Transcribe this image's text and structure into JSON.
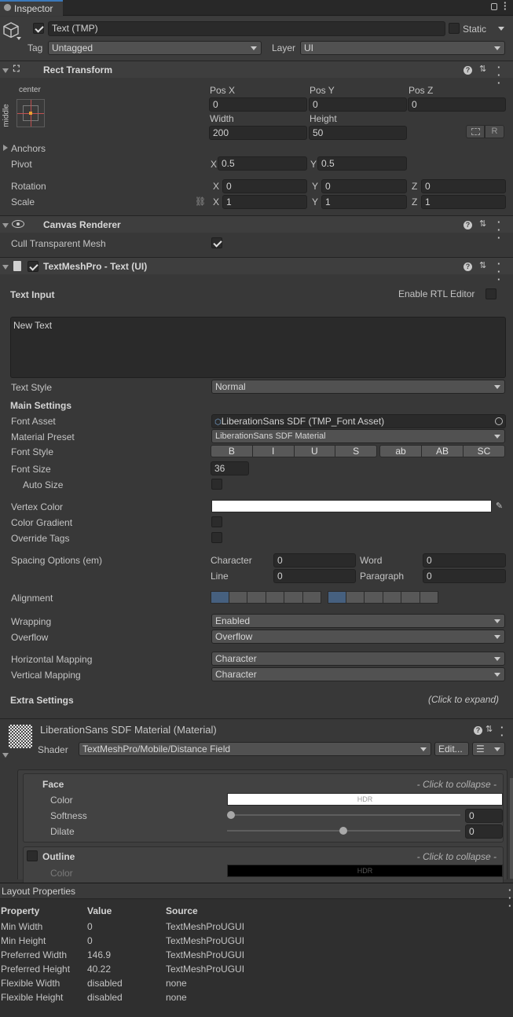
{
  "window": {
    "tab_title": "Inspector"
  },
  "object": {
    "name": "Text (TMP)",
    "active": true,
    "static_label": "Static",
    "static": false,
    "tag_label": "Tag",
    "tag_value": "Untagged",
    "layer_label": "Layer",
    "layer_value": "UI"
  },
  "rect_transform": {
    "title": "Rect Transform",
    "anchor_top": "center",
    "anchor_side": "middle",
    "pos_x_label": "Pos X",
    "pos_x": "0",
    "pos_y_label": "Pos Y",
    "pos_y": "0",
    "pos_z_label": "Pos Z",
    "pos_z": "0",
    "width_label": "Width",
    "width": "200",
    "height_label": "Height",
    "height": "50",
    "r_button": "R",
    "anchors_label": "Anchors",
    "pivot_label": "Pivot",
    "pivot_x": "0.5",
    "pivot_y": "0.5",
    "rotation_label": "Rotation",
    "rot_x": "0",
    "rot_y": "0",
    "rot_z": "0",
    "scale_label": "Scale",
    "scale_x": "1",
    "scale_y": "1",
    "scale_z": "1",
    "axis_x": "X",
    "axis_y": "Y",
    "axis_z": "Z"
  },
  "canvas_renderer": {
    "title": "Canvas Renderer",
    "cull_label": "Cull Transparent Mesh",
    "cull": true
  },
  "tmp": {
    "title": "TextMeshPro - Text (UI)",
    "enabled": true,
    "text_input_label": "Text Input",
    "rtl_label": "Enable RTL Editor",
    "text_value": "New Text",
    "text_style_label": "Text Style",
    "text_style": "Normal",
    "main_settings": "Main Settings",
    "font_asset_label": "Font Asset",
    "font_asset": "LiberationSans SDF (TMP_Font Asset)",
    "material_preset_label": "Material Preset",
    "material_preset": "LiberationSans SDF Material",
    "font_style_label": "Font Style",
    "font_styles": [
      "B",
      "I",
      "U",
      "S",
      "ab",
      "AB",
      "SC"
    ],
    "font_size_label": "Font Size",
    "font_size": "36",
    "auto_size_label": "Auto Size",
    "vertex_color_label": "Vertex Color",
    "vertex_color": "#ffffff",
    "color_gradient_label": "Color Gradient",
    "override_tags_label": "Override Tags",
    "spacing_label": "Spacing Options (em)",
    "character_label": "Character",
    "character": "0",
    "word_label": "Word",
    "word": "0",
    "line_label": "Line",
    "line": "0",
    "paragraph_label": "Paragraph",
    "paragraph": "0",
    "alignment_label": "Alignment",
    "wrapping_label": "Wrapping",
    "wrapping": "Enabled",
    "overflow_label": "Overflow",
    "overflow": "Overflow",
    "hmap_label": "Horizontal Mapping",
    "hmap": "Character",
    "vmap_label": "Vertical Mapping",
    "vmap": "Character",
    "extra_settings": "Extra Settings",
    "click_expand": "(Click to expand)"
  },
  "material": {
    "title": "LiberationSans SDF Material (Material)",
    "shader_label": "Shader",
    "shader": "TextMeshPro/Mobile/Distance Field",
    "edit_button": "Edit...",
    "face_label": "Face",
    "click_collapse": "- Click to collapse -",
    "color_label": "Color",
    "hdr": "HDR",
    "softness_label": "Softness",
    "softness": "0",
    "dilate_label": "Dilate",
    "dilate": "0",
    "outline_label": "Outline",
    "outline_color_label": "Color"
  },
  "layout_props": {
    "title": "Layout Properties",
    "headers": [
      "Property",
      "Value",
      "Source"
    ],
    "rows": [
      [
        "Min Width",
        "0",
        "TextMeshProUGUI"
      ],
      [
        "Min Height",
        "0",
        "TextMeshProUGUI"
      ],
      [
        "Preferred Width",
        "146.9",
        "TextMeshProUGUI"
      ],
      [
        "Preferred Height",
        "40.22",
        "TextMeshProUGUI"
      ],
      [
        "Flexible Width",
        "disabled",
        "none"
      ],
      [
        "Flexible Height",
        "disabled",
        "none"
      ]
    ]
  }
}
